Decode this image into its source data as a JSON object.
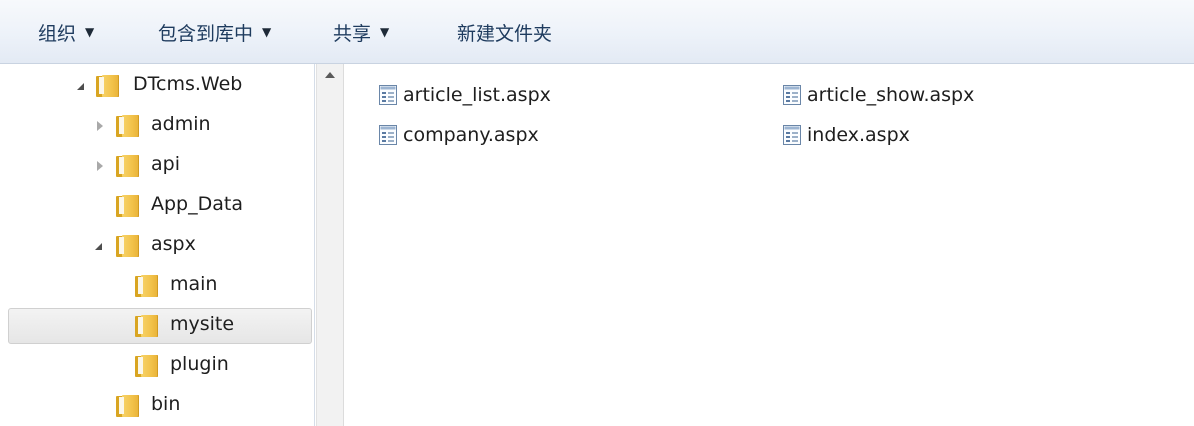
{
  "toolbar": {
    "organize": "组织",
    "include_library": "包含到库中",
    "share": "共享",
    "new_folder": "新建文件夹"
  },
  "nav": {
    "items": [
      {
        "label": "DTcms.Web",
        "expanded": true,
        "has_children": true
      },
      {
        "label": "admin",
        "expanded": false,
        "has_children": true
      },
      {
        "label": "api",
        "expanded": false,
        "has_children": true
      },
      {
        "label": "App_Data",
        "has_children": false
      },
      {
        "label": "aspx",
        "expanded": true,
        "has_children": true
      },
      {
        "label": "main",
        "has_children": false
      },
      {
        "label": "mysite",
        "has_children": false,
        "selected": true
      },
      {
        "label": "plugin",
        "has_children": false
      },
      {
        "label": "bin",
        "has_children": false
      }
    ]
  },
  "files": [
    {
      "name": "article_list.aspx",
      "icon": "aspx-file-icon"
    },
    {
      "name": "article_show.aspx",
      "icon": "aspx-file-icon"
    },
    {
      "name": "company.aspx",
      "icon": "aspx-file-icon"
    },
    {
      "name": "index.aspx",
      "icon": "aspx-file-icon"
    }
  ],
  "colors": {
    "folder": "#f2c24a",
    "selection": "#e6e6e6",
    "toolbar_text": "#1e3b5e"
  }
}
